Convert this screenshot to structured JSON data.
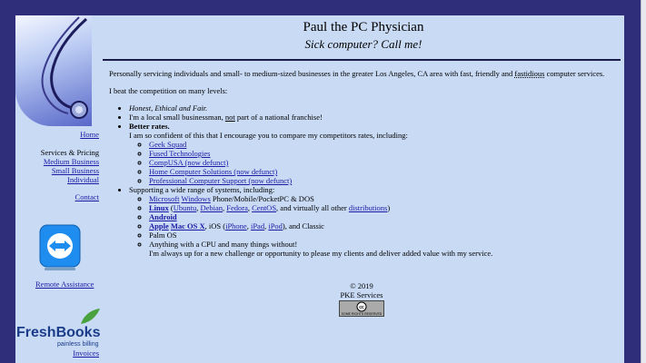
{
  "header": {
    "title": "Paul the PC Physician",
    "subtitle": "Sick computer? Call me!"
  },
  "sidebar": {
    "home": "Home",
    "services": "Services & Pricing",
    "medium": "Medium Business",
    "small": "Small Business",
    "individual": "Individual",
    "contact": "Contact",
    "remote": "Remote Assistance",
    "freshbooks_logo": "FreshBooks",
    "freshbooks_tag": "painless billing",
    "invoices": "Invoices"
  },
  "intro": {
    "a": "Personally servicing individuals and small- to medium-sized businesses in the greater Los Angeles, CA area with fast, friendly and ",
    "fastidious": "fastidious",
    "b": " computer services."
  },
  "beat": "I beat the competition on many levels:",
  "list": {
    "honest": "Honest, Ethical and Fair.",
    "local_a": "I'm a local small businessman, ",
    "local_not": "not",
    "local_b": " part of a national franchise!",
    "rates_title": "Better rates.",
    "rates_desc": "I am so confident of this that I encourage you to compare my competitors rates, including:",
    "competitors": [
      "Geek Squad",
      "Fused Technologies",
      "CompUSA (now defunct)",
      "Home Computer Solutions (now defunct)",
      "Professional Computer Support (now defunct)"
    ],
    "systems_title": "Supporting a wide range of systems, including:",
    "ms1": "Microsoft",
    "ms2": "Windows",
    "ms3": " Phone/Mobile/PocketPC & DOS",
    "linux": "Linux",
    "ubuntu": "Ubuntu",
    "debian": "Debian",
    "fedora": "Fedora",
    "centos": "CentOS",
    "linux_tail": ", and virtually all other ",
    "distributions": "distributions",
    "android": "Android",
    "apple": "Apple",
    "macos": "Mac OS X",
    "ios": ", iOS (",
    "iphone": "iPhone",
    "ipad": "iPad",
    "ipod": "iPod",
    "classic": "), and Classic",
    "palm": "Palm OS",
    "cpu": "Anything with a CPU and many things without!",
    "cpu2": "I'm always up for a new challenge or opportunity to please my clients and deliver added value with my service."
  },
  "footer": {
    "copy": "© 2019",
    "company": "PKE Services",
    "cc": "SOME RIGHTS RESERVED"
  }
}
